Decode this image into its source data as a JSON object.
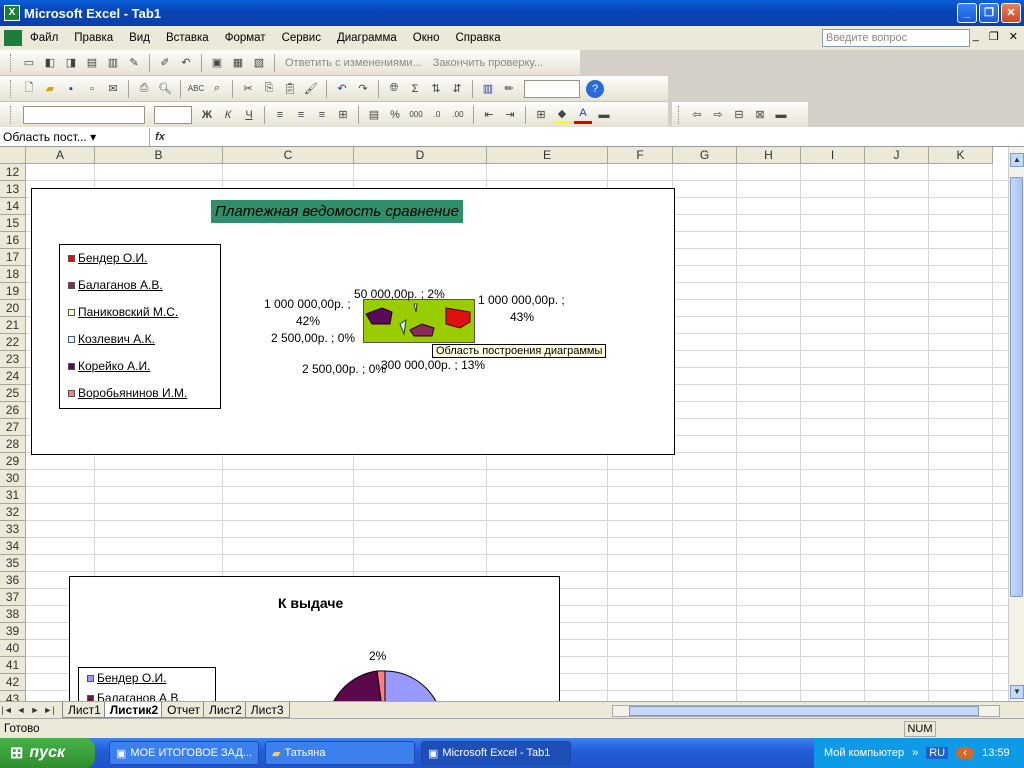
{
  "window": {
    "title": "Microsoft Excel - Tab1",
    "controls": [
      "_",
      "❐",
      "✕"
    ]
  },
  "menu": {
    "items": [
      "Файл",
      "Правка",
      "Вид",
      "Вставка",
      "Формат",
      "Сервис",
      "Диаграмма",
      "Окно",
      "Справка"
    ],
    "ask_placeholder": "Введите вопрос"
  },
  "toolbar1": {
    "reply_label": "Ответить с изменениями...",
    "finish_label": "Закончить проверку..."
  },
  "formula_bar": {
    "name_box": "Область пост...",
    "fx": "fx",
    "value": ""
  },
  "columns": [
    "A",
    "B",
    "C",
    "D",
    "E",
    "F",
    "G",
    "H",
    "I",
    "J",
    "K"
  ],
  "rows": [
    "12",
    "13",
    "14",
    "15",
    "16",
    "17",
    "18",
    "19",
    "20",
    "21",
    "22",
    "23",
    "24",
    "25",
    "26",
    "27",
    "28",
    "29",
    "30",
    "31",
    "32",
    "33",
    "34",
    "35",
    "36",
    "37",
    "38",
    "39",
    "40",
    "41",
    "42",
    "43"
  ],
  "chart1": {
    "title": "Платежная ведомость сравнение",
    "legend": [
      {
        "label": "Бендер О.И.",
        "color": "#e01010"
      },
      {
        "label": "Балаганов А.В.",
        "color": "#8b2a5a"
      },
      {
        "label": "Паниковский М.С.",
        "color": "#ffffcc"
      },
      {
        "label": "Козлевич А.К.",
        "color": "#ccffff"
      },
      {
        "label": "Корейко А.И.",
        "color": "#5a0a5a"
      },
      {
        "label": "Воробьянинов И.М.",
        "color": "#ff8080"
      }
    ],
    "data_labels": {
      "l1a": "50 000,00р. ; 2%",
      "l2a": "1 000 000,00р. ;",
      "l2b": "42%",
      "l3a": "1 000 000,00р. ;",
      "l3b": "43%",
      "l4": "2 500,00р. ; 0%",
      "l5": "2 500,00р. ; 0%",
      "l6": "300 000,00р. ; 13%"
    },
    "plot_area_color": "#9acd00",
    "tooltip": "Область построения диаграммы"
  },
  "chart_data": {
    "type": "pie",
    "title": "Платежная ведомость сравнение",
    "categories": [
      "Бендер О.И.",
      "Балаганов А.В.",
      "Паниковский М.С.",
      "Козлевич А.К.",
      "Корейко А.И.",
      "Воробьянинов И.М."
    ],
    "values": [
      1000000,
      300000,
      2500,
      2500,
      1000000,
      50000
    ],
    "percent": [
      43,
      13,
      0,
      0,
      42,
      2
    ]
  },
  "chart2": {
    "title": "К выдаче",
    "legend": [
      {
        "label": "Бендер О.И.",
        "color": "#9999ff"
      },
      {
        "label": "Балаганов А.В.",
        "color": "#6a1a4a"
      }
    ],
    "data_label": "2%"
  },
  "sheet_tabs": [
    "Лист1",
    "Листик2",
    "Отчет",
    "Лист2",
    "Лист3"
  ],
  "active_tab": "Листик2",
  "status": {
    "text": "Готово",
    "num": "NUM"
  },
  "taskbar": {
    "start": "пуск",
    "tasks": [
      "МОЕ ИТОГОВОЕ ЗАД...",
      "Татьяна",
      "Microsoft Excel - Tab1"
    ],
    "tray_label": "Мой компьютер",
    "lang": "RU",
    "time": "13:59"
  }
}
